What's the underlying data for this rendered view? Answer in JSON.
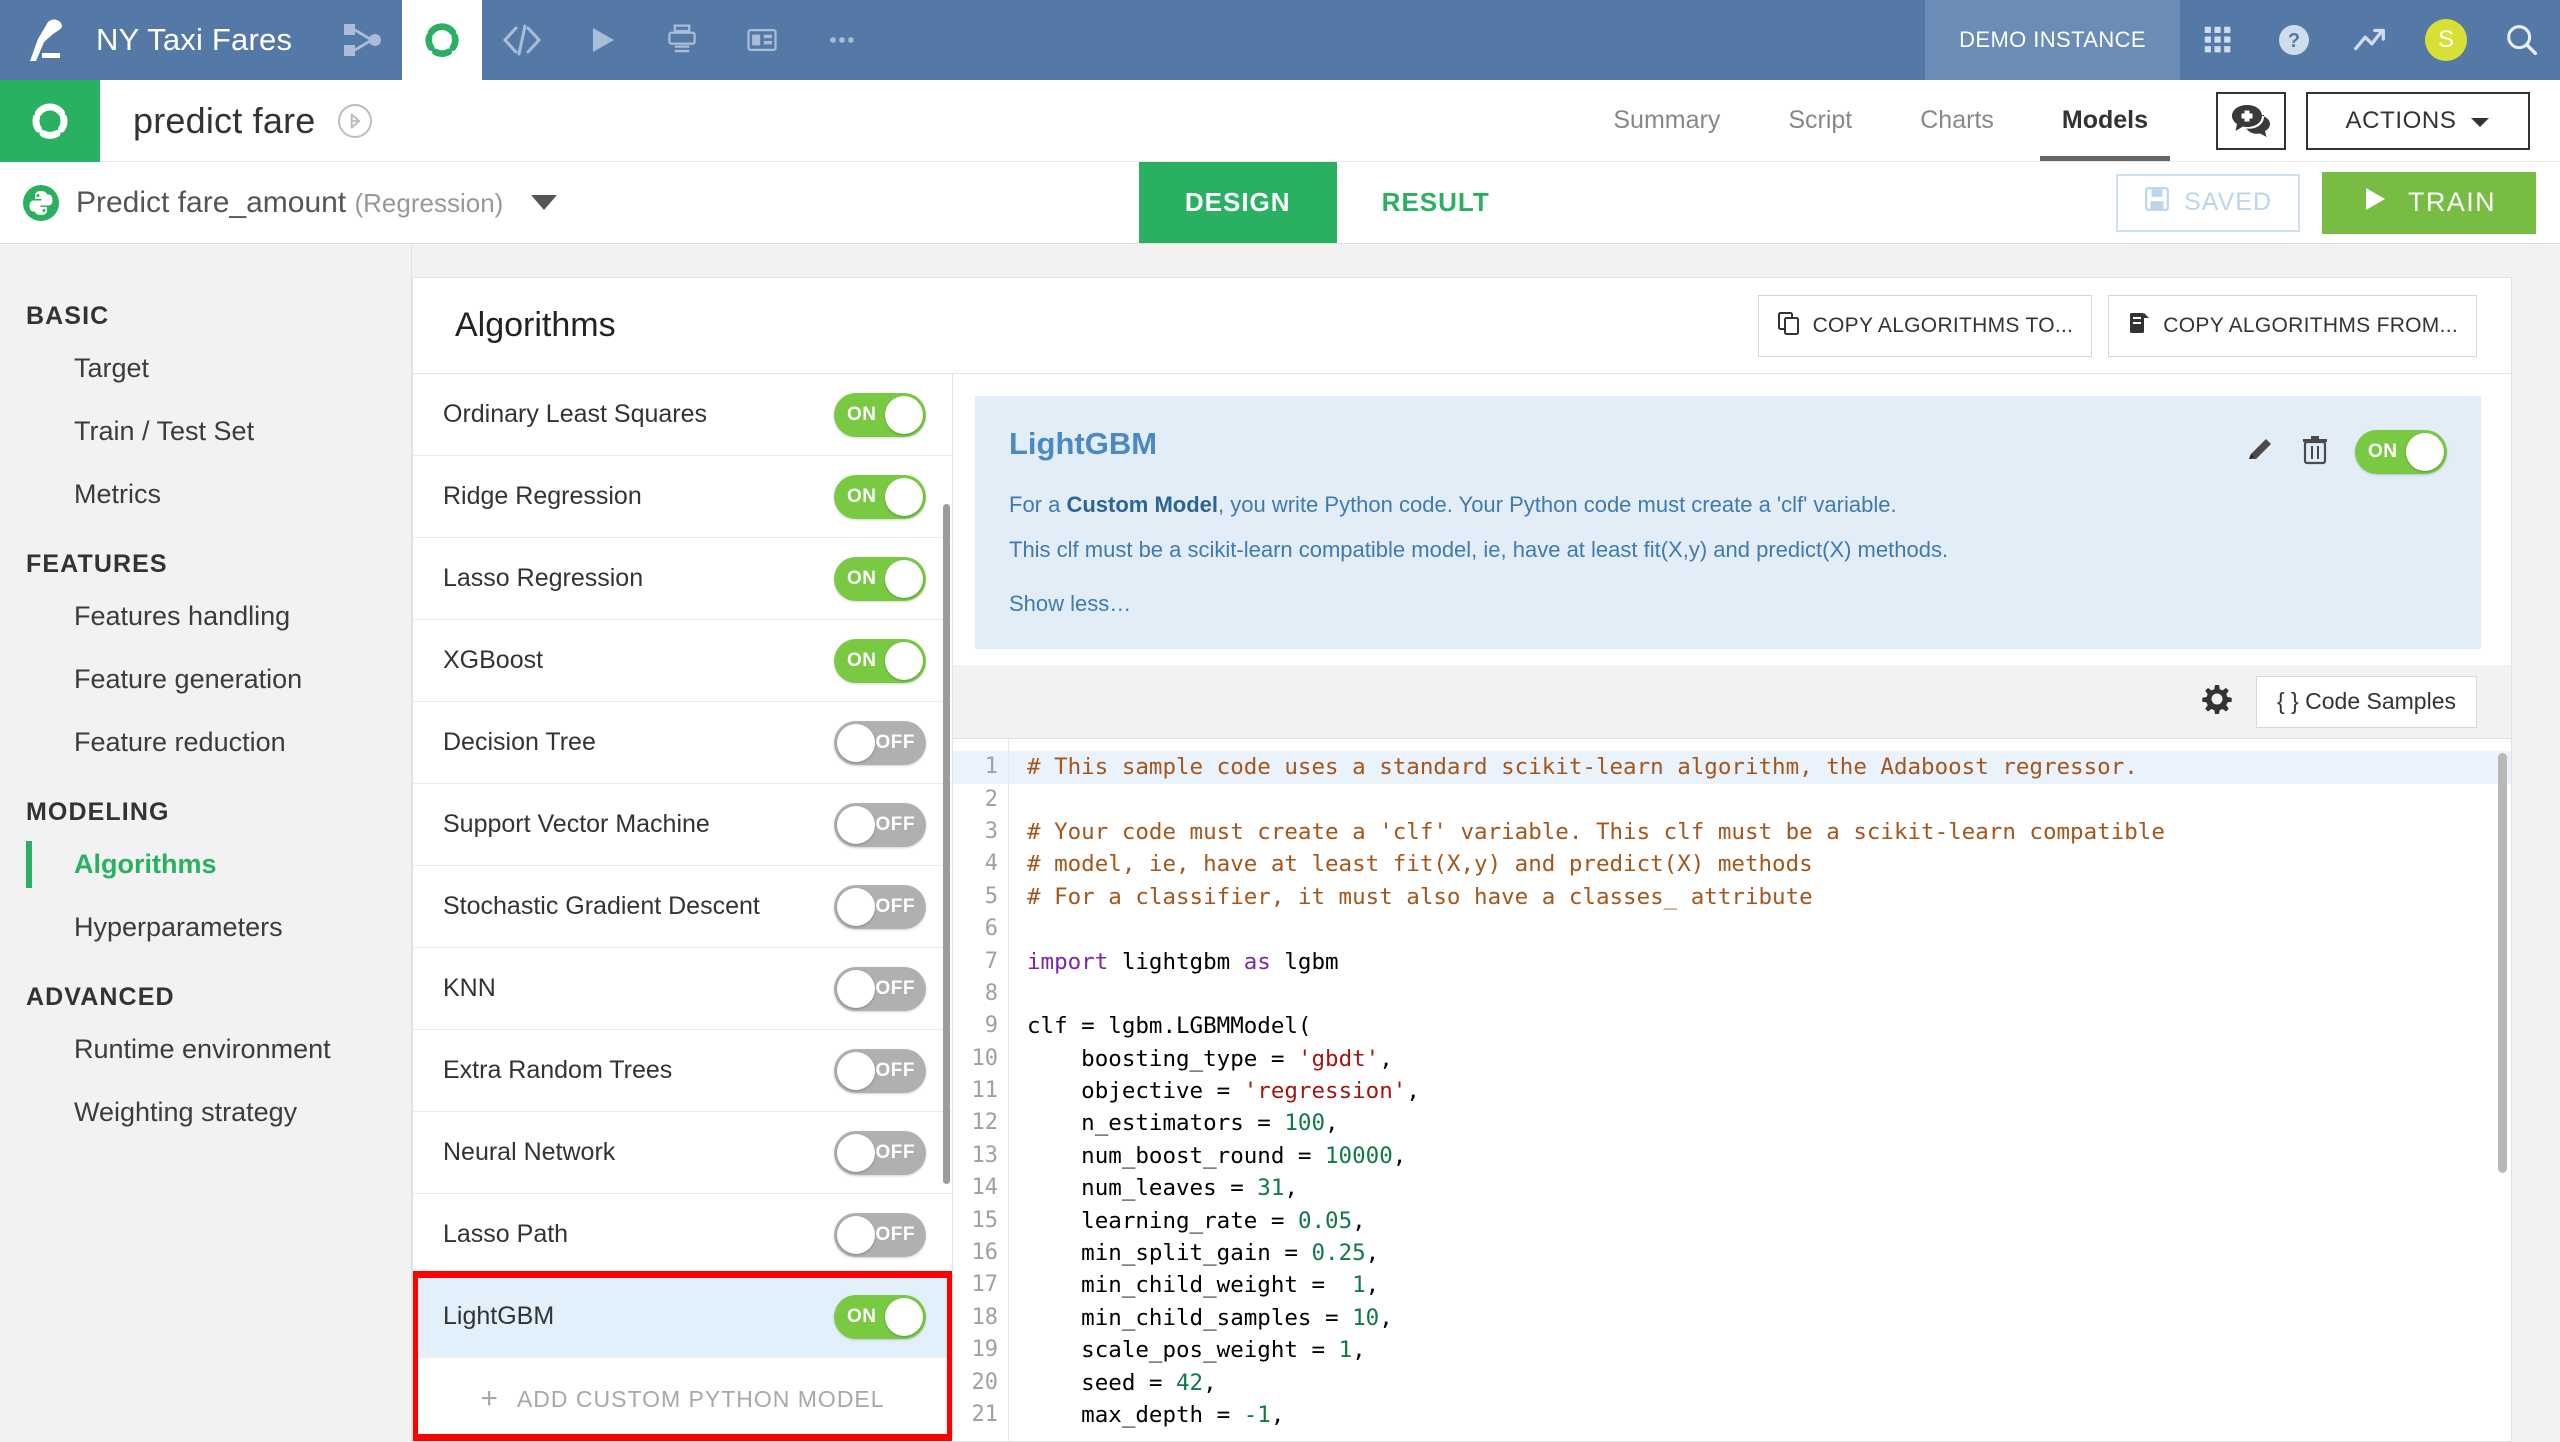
{
  "topbar": {
    "project_name": "NY Taxi Fares",
    "instance_label": "DEMO INSTANCE",
    "icons": [
      {
        "name": "flow-icon"
      },
      {
        "name": "lab-icon"
      },
      {
        "name": "code-icon"
      },
      {
        "name": "jobs-icon"
      },
      {
        "name": "scenarios-icon"
      },
      {
        "name": "dashboards-icon"
      },
      {
        "name": "more-icon"
      }
    ],
    "right_icons": [
      {
        "name": "apps-grid-icon"
      },
      {
        "name": "help-icon"
      },
      {
        "name": "monitoring-icon"
      }
    ],
    "avatar_initial": "S",
    "search_icon": "search-icon"
  },
  "subheader": {
    "analysis_title": "predict fare",
    "flow_badge_icon": "flow-zone-icon",
    "tabs": [
      {
        "label": "Summary",
        "active": false
      },
      {
        "label": "Script",
        "active": false
      },
      {
        "label": "Charts",
        "active": false
      },
      {
        "label": "Models",
        "active": true
      }
    ],
    "chat_icon": "add-discussion-icon",
    "actions_label": "ACTIONS",
    "actions_caret": "caret-down-icon"
  },
  "modelbar": {
    "python_icon": "python-icon",
    "model_name": "Predict fare_amount",
    "model_type": "(Regression)",
    "caret_icon": "caret-down-icon",
    "tabs": [
      {
        "label": "DESIGN",
        "active": true
      },
      {
        "label": "RESULT",
        "active": false
      }
    ],
    "saved_label": "SAVED",
    "saved_icon": "floppy-disk-icon",
    "train_label": "TRAIN",
    "train_icon": "play-icon"
  },
  "sidebar": {
    "groups": [
      {
        "title": "BASIC",
        "items": [
          {
            "label": "Target",
            "active": false
          },
          {
            "label": "Train / Test Set",
            "active": false
          },
          {
            "label": "Metrics",
            "active": false
          }
        ]
      },
      {
        "title": "FEATURES",
        "items": [
          {
            "label": "Features handling",
            "active": false
          },
          {
            "label": "Feature generation",
            "active": false
          },
          {
            "label": "Feature reduction",
            "active": false
          }
        ]
      },
      {
        "title": "MODELING",
        "items": [
          {
            "label": "Algorithms",
            "active": true
          },
          {
            "label": "Hyperparameters",
            "active": false
          }
        ]
      },
      {
        "title": "ADVANCED",
        "items": [
          {
            "label": "Runtime environment",
            "active": false
          },
          {
            "label": "Weighting strategy",
            "active": false
          }
        ]
      }
    ]
  },
  "panel": {
    "title": "Algorithms",
    "copy_to_label": "COPY ALGORITHMS TO...",
    "copy_to_icon": "copy-to-icon",
    "copy_from_label": "COPY ALGORITHMS FROM...",
    "copy_from_icon": "copy-from-icon"
  },
  "algorithms": [
    {
      "name": "Ordinary Least Squares",
      "state": "ON",
      "selected": false
    },
    {
      "name": "Ridge Regression",
      "state": "ON",
      "selected": false
    },
    {
      "name": "Lasso Regression",
      "state": "ON",
      "selected": false
    },
    {
      "name": "XGBoost",
      "state": "ON",
      "selected": false
    },
    {
      "name": "Decision Tree",
      "state": "OFF",
      "selected": false
    },
    {
      "name": "Support Vector Machine",
      "state": "OFF",
      "selected": false
    },
    {
      "name": "Stochastic Gradient Descent",
      "state": "OFF",
      "selected": false
    },
    {
      "name": "KNN",
      "state": "OFF",
      "selected": false
    },
    {
      "name": "Extra Random Trees",
      "state": "OFF",
      "selected": false
    },
    {
      "name": "Neural Network",
      "state": "OFF",
      "selected": false
    },
    {
      "name": "Lasso Path",
      "state": "OFF",
      "selected": false
    },
    {
      "name": "LightGBM",
      "state": "ON",
      "selected": true
    }
  ],
  "add_custom_label": "ADD CUSTOM PYTHON MODEL",
  "detail": {
    "title": "LightGBM",
    "desc_prefix": "For a ",
    "desc_bold": "Custom Model",
    "desc_suffix": ", you write Python code. Your Python code must create a 'clf' variable.",
    "desc_line2": "This clf must be a scikit-learn compatible model, ie, have at least fit(X,y) and predict(X) methods.",
    "show_less": "Show less…",
    "edit_icon": "pencil-icon",
    "delete_icon": "trash-icon",
    "toggle_state": "ON"
  },
  "editor": {
    "settings_icon": "gear-icon",
    "code_samples_label": "{ } Code Samples",
    "lines": [
      {
        "n": 1,
        "highlight": true,
        "fold": false,
        "tokens": [
          {
            "t": "# This sample code uses a standard scikit-learn algorithm, the Adaboost regressor.",
            "c": "cm"
          }
        ]
      },
      {
        "n": 2,
        "highlight": false,
        "fold": false,
        "tokens": []
      },
      {
        "n": 3,
        "highlight": false,
        "fold": false,
        "tokens": [
          {
            "t": "# Your code must create a 'clf' variable. This clf must be a scikit-learn compatible",
            "c": "cm"
          }
        ]
      },
      {
        "n": 4,
        "highlight": false,
        "fold": false,
        "tokens": [
          {
            "t": "# model, ie, have at least fit(X,y) and predict(X) methods",
            "c": "cm"
          }
        ]
      },
      {
        "n": 5,
        "highlight": false,
        "fold": false,
        "tokens": [
          {
            "t": "# For a classifier, it must also have a classes_ attribute",
            "c": "cm"
          }
        ]
      },
      {
        "n": 6,
        "highlight": false,
        "fold": false,
        "tokens": []
      },
      {
        "n": 7,
        "highlight": false,
        "fold": false,
        "tokens": [
          {
            "t": "import",
            "c": "kw"
          },
          {
            "t": " lightgbm ",
            "c": ""
          },
          {
            "t": "as",
            "c": "kw"
          },
          {
            "t": " lgbm",
            "c": ""
          }
        ]
      },
      {
        "n": 8,
        "highlight": false,
        "fold": false,
        "tokens": []
      },
      {
        "n": 9,
        "highlight": false,
        "fold": true,
        "tokens": [
          {
            "t": "clf = lgbm.LGBMModel(",
            "c": ""
          }
        ]
      },
      {
        "n": 10,
        "highlight": false,
        "fold": false,
        "tokens": [
          {
            "t": "    boosting_type = ",
            "c": ""
          },
          {
            "t": "'gbdt'",
            "c": "st"
          },
          {
            "t": ",",
            "c": ""
          }
        ]
      },
      {
        "n": 11,
        "highlight": false,
        "fold": false,
        "tokens": [
          {
            "t": "    objective = ",
            "c": ""
          },
          {
            "t": "'regression'",
            "c": "st"
          },
          {
            "t": ",",
            "c": ""
          }
        ]
      },
      {
        "n": 12,
        "highlight": false,
        "fold": false,
        "tokens": [
          {
            "t": "    n_estimators = ",
            "c": ""
          },
          {
            "t": "100",
            "c": "nu"
          },
          {
            "t": ",",
            "c": ""
          }
        ]
      },
      {
        "n": 13,
        "highlight": false,
        "fold": false,
        "tokens": [
          {
            "t": "    num_boost_round = ",
            "c": ""
          },
          {
            "t": "10000",
            "c": "nu"
          },
          {
            "t": ",",
            "c": ""
          }
        ]
      },
      {
        "n": 14,
        "highlight": false,
        "fold": false,
        "tokens": [
          {
            "t": "    num_leaves = ",
            "c": ""
          },
          {
            "t": "31",
            "c": "nu"
          },
          {
            "t": ",",
            "c": ""
          }
        ]
      },
      {
        "n": 15,
        "highlight": false,
        "fold": false,
        "tokens": [
          {
            "t": "    learning_rate = ",
            "c": ""
          },
          {
            "t": "0.05",
            "c": "nu"
          },
          {
            "t": ",",
            "c": ""
          }
        ]
      },
      {
        "n": 16,
        "highlight": false,
        "fold": false,
        "tokens": [
          {
            "t": "    min_split_gain = ",
            "c": ""
          },
          {
            "t": "0.25",
            "c": "nu"
          },
          {
            "t": ",",
            "c": ""
          }
        ]
      },
      {
        "n": 17,
        "highlight": false,
        "fold": false,
        "tokens": [
          {
            "t": "    min_child_weight =  ",
            "c": ""
          },
          {
            "t": "1",
            "c": "nu"
          },
          {
            "t": ",",
            "c": ""
          }
        ]
      },
      {
        "n": 18,
        "highlight": false,
        "fold": false,
        "tokens": [
          {
            "t": "    min_child_samples = ",
            "c": ""
          },
          {
            "t": "10",
            "c": "nu"
          },
          {
            "t": ",",
            "c": ""
          }
        ]
      },
      {
        "n": 19,
        "highlight": false,
        "fold": false,
        "tokens": [
          {
            "t": "    scale_pos_weight = ",
            "c": ""
          },
          {
            "t": "1",
            "c": "nu"
          },
          {
            "t": ",",
            "c": ""
          }
        ]
      },
      {
        "n": 20,
        "highlight": false,
        "fold": false,
        "tokens": [
          {
            "t": "    seed = ",
            "c": ""
          },
          {
            "t": "42",
            "c": "nu"
          },
          {
            "t": ",",
            "c": ""
          }
        ]
      },
      {
        "n": 21,
        "highlight": false,
        "fold": false,
        "tokens": [
          {
            "t": "    max_depth = ",
            "c": ""
          },
          {
            "t": "-1",
            "c": "nu"
          },
          {
            "t": ",",
            "c": ""
          }
        ]
      }
    ]
  },
  "colors": {
    "nav_blue": "#5579a6",
    "brand_green": "#2ab061",
    "toggle_on": "#7ac943",
    "toggle_off": "#b0b0b0",
    "train_green": "#77bc43",
    "highlight_red": "#ff0000",
    "info_blue": "#e2edf8"
  }
}
